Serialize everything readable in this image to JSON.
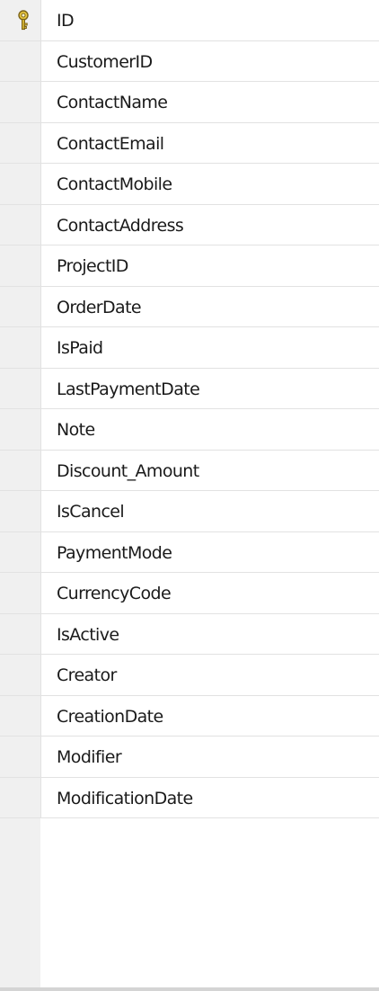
{
  "columns": [
    {
      "name": "ID",
      "primary_key": true
    },
    {
      "name": "CustomerID"
    },
    {
      "name": "ContactName"
    },
    {
      "name": "ContactEmail"
    },
    {
      "name": "ContactMobile"
    },
    {
      "name": "ContactAddress"
    },
    {
      "name": "ProjectID"
    },
    {
      "name": "OrderDate"
    },
    {
      "name": "IsPaid"
    },
    {
      "name": "LastPaymentDate"
    },
    {
      "name": "Note"
    },
    {
      "name": "Discount_Amount"
    },
    {
      "name": "IsCancel"
    },
    {
      "name": "PaymentMode"
    },
    {
      "name": "CurrencyCode"
    },
    {
      "name": "IsActive"
    },
    {
      "name": "Creator"
    },
    {
      "name": "CreationDate"
    },
    {
      "name": "Modifier"
    },
    {
      "name": "ModificationDate"
    }
  ],
  "icons": {
    "primary_key": "key-icon"
  },
  "colors": {
    "gutter": "#f0f0f0",
    "grid_line": "#e2e2e2",
    "text": "#1a1a1a",
    "key_gold": "#d8b32a"
  }
}
